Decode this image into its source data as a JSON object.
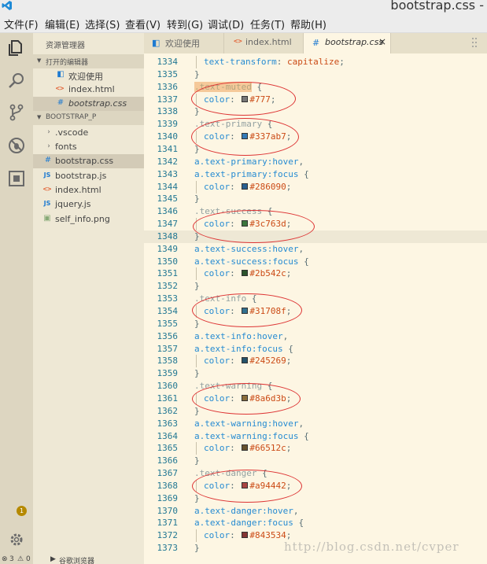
{
  "window": {
    "title": "bootstrap.css -"
  },
  "menu": [
    "文件(F)",
    "编辑(E)",
    "选择(S)",
    "查看(V)",
    "转到(G)",
    "调试(D)",
    "任务(T)",
    "帮助(H)"
  ],
  "activity": {
    "badge_count": "1"
  },
  "sidebar": {
    "title": "资源管理器",
    "open_editors_header": "打开的编辑器",
    "open_editors": [
      {
        "label": "欢迎使用",
        "icon": "vscode-icon"
      },
      {
        "label": "index.html",
        "icon": "html-icon"
      },
      {
        "label": "bootstrap.css",
        "icon": "css-icon"
      }
    ],
    "project_header": "BOOTSTRAP_P",
    "project_items": [
      {
        "label": ".vscode",
        "icon": "chevron-right-icon"
      },
      {
        "label": "fonts",
        "icon": "chevron-right-icon"
      },
      {
        "label": "bootstrap.css",
        "icon": "css-icon"
      },
      {
        "label": "bootstrap.js",
        "icon": "js-icon"
      },
      {
        "label": "index.html",
        "icon": "html-icon"
      },
      {
        "label": "jquery.js",
        "icon": "js-icon"
      },
      {
        "label": "self_info.png",
        "icon": "image-icon"
      }
    ]
  },
  "status": {
    "errors": "3",
    "warnings": "0",
    "extra": "谷歌浏览器"
  },
  "tabs": [
    {
      "label": "欢迎使用",
      "icon": "vscode-icon"
    },
    {
      "label": "index.html",
      "icon": "html-icon"
    },
    {
      "label": "bootstrap.css",
      "icon": "css-icon",
      "close": "×"
    }
  ],
  "editor": {
    "lines": [
      {
        "n": "1334",
        "indent": true,
        "parts": [
          [
            "prop",
            "text-transform"
          ],
          [
            "punc",
            ": "
          ],
          [
            "val",
            "capitalize"
          ],
          [
            "punc",
            ";"
          ]
        ]
      },
      {
        "n": "1335",
        "parts": [
          [
            "punc",
            "}"
          ]
        ]
      },
      {
        "n": "1336",
        "parts": [
          [
            "hl",
            ".text-muted"
          ],
          [
            "punc",
            " {"
          ]
        ]
      },
      {
        "n": "1337",
        "indent": true,
        "parts": [
          [
            "prop",
            "color"
          ],
          [
            "punc",
            ": "
          ],
          [
            "swatch",
            "#777777"
          ],
          [
            "val",
            "#777"
          ],
          [
            "punc",
            ";"
          ]
        ]
      },
      {
        "n": "1338",
        "parts": [
          [
            "punc",
            "}"
          ]
        ]
      },
      {
        "n": "1339",
        "parts": [
          [
            "seldim",
            ".text-primary"
          ],
          [
            "punc",
            " {"
          ]
        ]
      },
      {
        "n": "1340",
        "indent": true,
        "parts": [
          [
            "prop",
            "color"
          ],
          [
            "punc",
            ": "
          ],
          [
            "swatch",
            "#337ab7"
          ],
          [
            "val",
            "#337ab7"
          ],
          [
            "punc",
            ";"
          ]
        ]
      },
      {
        "n": "1341",
        "parts": [
          [
            "punc",
            "}"
          ]
        ]
      },
      {
        "n": "1342",
        "parts": [
          [
            "sel",
            "a.text-primary:hover"
          ],
          [
            "punc",
            ","
          ]
        ]
      },
      {
        "n": "1343",
        "parts": [
          [
            "sel",
            "a.text-primary:focus"
          ],
          [
            "punc",
            " {"
          ]
        ]
      },
      {
        "n": "1344",
        "indent": true,
        "parts": [
          [
            "prop",
            "color"
          ],
          [
            "punc",
            ": "
          ],
          [
            "swatch",
            "#286090"
          ],
          [
            "val",
            "#286090"
          ],
          [
            "punc",
            ";"
          ]
        ]
      },
      {
        "n": "1345",
        "parts": [
          [
            "punc",
            "}"
          ]
        ]
      },
      {
        "n": "1346",
        "parts": [
          [
            "seldim",
            ".text-success"
          ],
          [
            "punc",
            " {"
          ]
        ]
      },
      {
        "n": "1347",
        "indent": true,
        "parts": [
          [
            "prop",
            "color"
          ],
          [
            "punc",
            ": "
          ],
          [
            "swatch",
            "#3c763d"
          ],
          [
            "val",
            "#3c763d"
          ],
          [
            "punc",
            ";"
          ]
        ]
      },
      {
        "n": "1348",
        "current": true,
        "parts": [
          [
            "punc",
            "}"
          ]
        ]
      },
      {
        "n": "1349",
        "parts": [
          [
            "sel",
            "a.text-success:hover"
          ],
          [
            "punc",
            ","
          ]
        ]
      },
      {
        "n": "1350",
        "parts": [
          [
            "sel",
            "a.text-success:focus"
          ],
          [
            "punc",
            " {"
          ]
        ]
      },
      {
        "n": "1351",
        "indent": true,
        "parts": [
          [
            "prop",
            "color"
          ],
          [
            "punc",
            ": "
          ],
          [
            "swatch",
            "#2b542c"
          ],
          [
            "val",
            "#2b542c"
          ],
          [
            "punc",
            ";"
          ]
        ]
      },
      {
        "n": "1352",
        "parts": [
          [
            "punc",
            "}"
          ]
        ]
      },
      {
        "n": "1353",
        "parts": [
          [
            "seldim",
            ".text-info"
          ],
          [
            "punc",
            " {"
          ]
        ]
      },
      {
        "n": "1354",
        "indent": true,
        "parts": [
          [
            "prop",
            "color"
          ],
          [
            "punc",
            ": "
          ],
          [
            "swatch",
            "#31708f"
          ],
          [
            "val",
            "#31708f"
          ],
          [
            "punc",
            ";"
          ]
        ]
      },
      {
        "n": "1355",
        "parts": [
          [
            "punc",
            "}"
          ]
        ]
      },
      {
        "n": "1356",
        "parts": [
          [
            "sel",
            "a.text-info:hover"
          ],
          [
            "punc",
            ","
          ]
        ]
      },
      {
        "n": "1357",
        "parts": [
          [
            "sel",
            "a.text-info:focus"
          ],
          [
            "punc",
            " {"
          ]
        ]
      },
      {
        "n": "1358",
        "indent": true,
        "parts": [
          [
            "prop",
            "color"
          ],
          [
            "punc",
            ": "
          ],
          [
            "swatch",
            "#245269"
          ],
          [
            "val",
            "#245269"
          ],
          [
            "punc",
            ";"
          ]
        ]
      },
      {
        "n": "1359",
        "parts": [
          [
            "punc",
            "}"
          ]
        ]
      },
      {
        "n": "1360",
        "parts": [
          [
            "seldim",
            ".text-warning"
          ],
          [
            "punc",
            " {"
          ]
        ]
      },
      {
        "n": "1361",
        "indent": true,
        "parts": [
          [
            "prop",
            "color"
          ],
          [
            "punc",
            ": "
          ],
          [
            "swatch",
            "#8a6d3b"
          ],
          [
            "val",
            "#8a6d3b"
          ],
          [
            "punc",
            ";"
          ]
        ]
      },
      {
        "n": "1362",
        "parts": [
          [
            "punc",
            "}"
          ]
        ]
      },
      {
        "n": "1363",
        "parts": [
          [
            "sel",
            "a.text-warning:hover"
          ],
          [
            "punc",
            ","
          ]
        ]
      },
      {
        "n": "1364",
        "parts": [
          [
            "sel",
            "a.text-warning:focus"
          ],
          [
            "punc",
            " {"
          ]
        ]
      },
      {
        "n": "1365",
        "indent": true,
        "parts": [
          [
            "prop",
            "color"
          ],
          [
            "punc",
            ": "
          ],
          [
            "swatch",
            "#66512c"
          ],
          [
            "val",
            "#66512c"
          ],
          [
            "punc",
            ";"
          ]
        ]
      },
      {
        "n": "1366",
        "parts": [
          [
            "punc",
            "}"
          ]
        ]
      },
      {
        "n": "1367",
        "parts": [
          [
            "seldim",
            ".text-danger"
          ],
          [
            "punc",
            " {"
          ]
        ]
      },
      {
        "n": "1368",
        "indent": true,
        "parts": [
          [
            "prop",
            "color"
          ],
          [
            "punc",
            ": "
          ],
          [
            "swatch",
            "#a94442"
          ],
          [
            "val",
            "#a94442"
          ],
          [
            "punc",
            ";"
          ]
        ]
      },
      {
        "n": "1369",
        "parts": [
          [
            "punc",
            "}"
          ]
        ]
      },
      {
        "n": "1370",
        "parts": [
          [
            "sel",
            "a.text-danger:hover"
          ],
          [
            "punc",
            ","
          ]
        ]
      },
      {
        "n": "1371",
        "parts": [
          [
            "sel",
            "a.text-danger:focus"
          ],
          [
            "punc",
            " {"
          ]
        ]
      },
      {
        "n": "1372",
        "indent": true,
        "parts": [
          [
            "prop",
            "color"
          ],
          [
            "punc",
            ": "
          ],
          [
            "swatch",
            "#843534"
          ],
          [
            "val",
            "#843534"
          ],
          [
            "punc",
            ";"
          ]
        ]
      },
      {
        "n": "1373",
        "parts": [
          [
            "punc",
            "}"
          ]
        ]
      }
    ]
  },
  "watermark": "http://blog.csdn.net/cvper"
}
